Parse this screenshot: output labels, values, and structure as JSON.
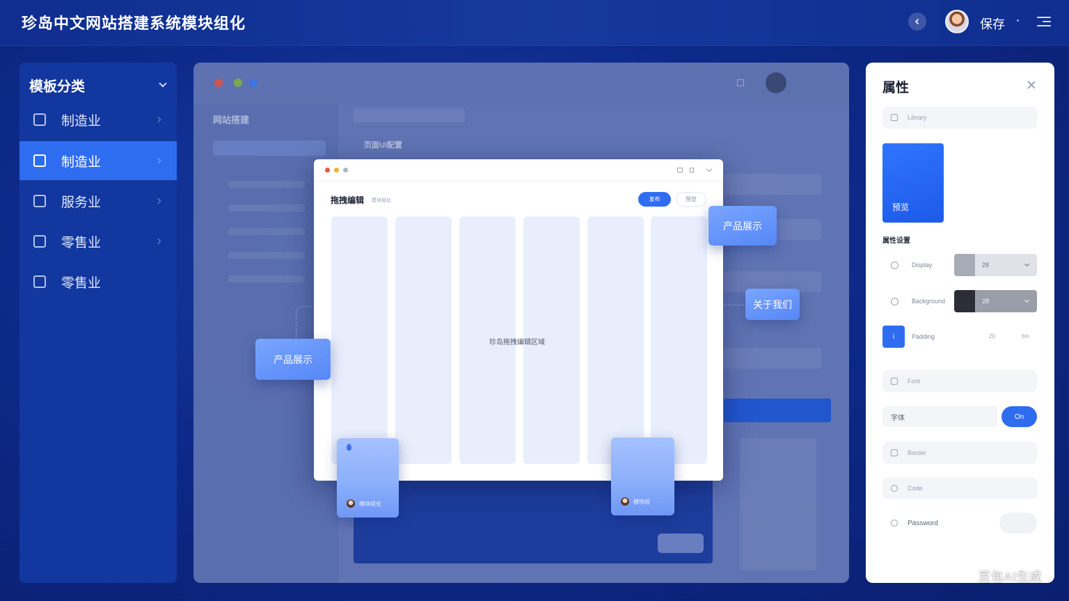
{
  "header": {
    "title": "珍岛中文网站搭建系统模块组化",
    "save_label": "保存"
  },
  "sidebar": {
    "title": "模板分类",
    "items": [
      {
        "label": "制造业",
        "icon": "home-icon",
        "active": false
      },
      {
        "label": "制造业",
        "icon": "layout-icon",
        "active": true
      },
      {
        "label": "服务业",
        "icon": "service-icon",
        "active": false
      },
      {
        "label": "零售业",
        "icon": "store-icon",
        "active": false
      },
      {
        "label": "零售业",
        "icon": "lock-icon",
        "active": false
      }
    ]
  },
  "workspace": {
    "left_title": "网站搭建",
    "sub_title": "页面UI配置"
  },
  "canvas": {
    "title": "拖拽编辑",
    "subtitle": "模块组化",
    "primary_button": "发布",
    "ghost_button": "预览",
    "center_text": "珍岛拖拽编辑区域"
  },
  "floating_cards": {
    "product_right": "产品展示",
    "about": "关于我们",
    "product_left": "产品展示",
    "tall_left_label": "模块组化",
    "tall_right_label": "模块组"
  },
  "properties": {
    "title": "属性",
    "search_placeholder": "Library",
    "preview_label": "预览",
    "section_label": "属性设置",
    "rows": [
      {
        "label": "Display",
        "value": "28"
      },
      {
        "label": "Background",
        "value": "28"
      },
      {
        "label": "Padding",
        "value": "20"
      }
    ],
    "padding_extra": "6m",
    "field_font": "Font",
    "text_label": "字体",
    "toggle_label": "On",
    "field_border": "Border",
    "field_code": "Code",
    "field_password": "Password"
  },
  "watermark": "豆包AI生成",
  "colors": {
    "accent": "#2f6df0",
    "background": "#0d2a8a",
    "card": "#6a98f8"
  }
}
